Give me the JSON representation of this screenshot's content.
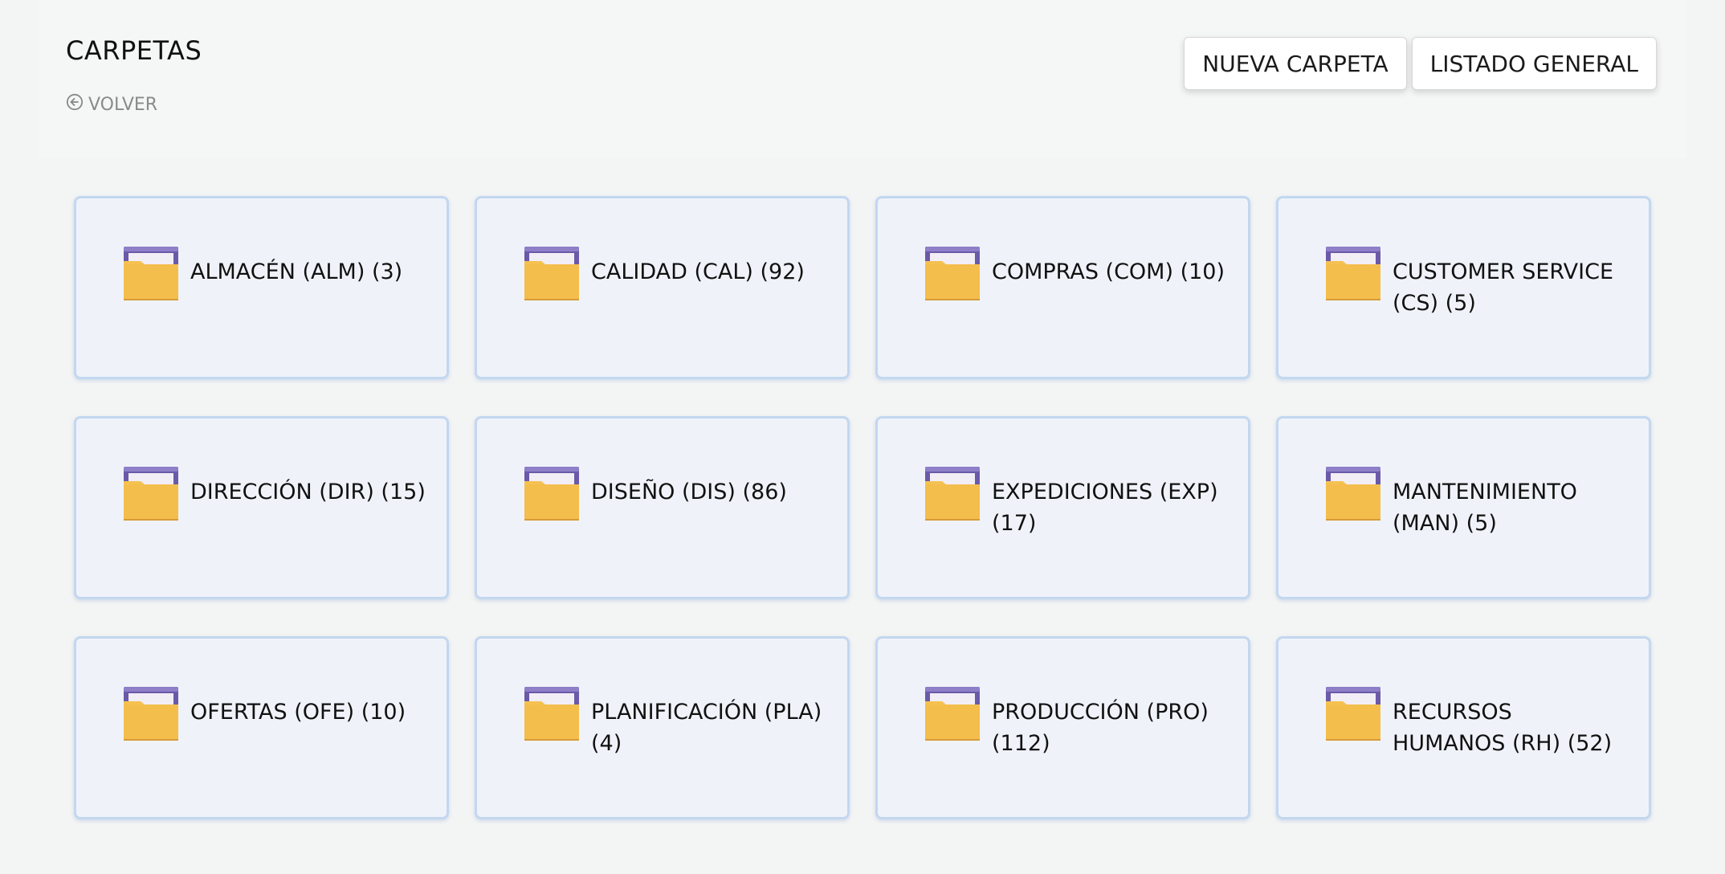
{
  "header": {
    "title": "CARPETAS",
    "back_label": "VOLVER",
    "new_folder_label": "NUEVA CARPETA",
    "general_list_label": "LISTADO GENERAL"
  },
  "folders": [
    {
      "label": "ALMACÉN (ALM) (3)"
    },
    {
      "label": "CALIDAD (CAL) (92)"
    },
    {
      "label": "COMPRAS (COM) (10)"
    },
    {
      "label": "CUSTOMER SERVICE (CS) (5)"
    },
    {
      "label": "DIRECCIÓN (DIR) (15)"
    },
    {
      "label": "DISEÑO (DIS) (86)"
    },
    {
      "label": "EXPEDICIONES (EXP) (17)"
    },
    {
      "label": "MANTENIMIENTO (MAN) (5)"
    },
    {
      "label": "OFERTAS (OFE) (10)"
    },
    {
      "label": "PLANIFICACIÓN (PLA) (4)"
    },
    {
      "label": "PRODUCCIÓN (PRO) (112)"
    },
    {
      "label": "RECURSOS HUMANOS (RH) (52)"
    }
  ],
  "colors": {
    "folder_body": "#f5c150",
    "folder_tab": "#6a5aa8",
    "card_border": "#c3d7f0",
    "card_bg": "#eff3f9"
  },
  "icons": {
    "back": "arrow-left-circle-icon",
    "folder": "folder-icon"
  }
}
